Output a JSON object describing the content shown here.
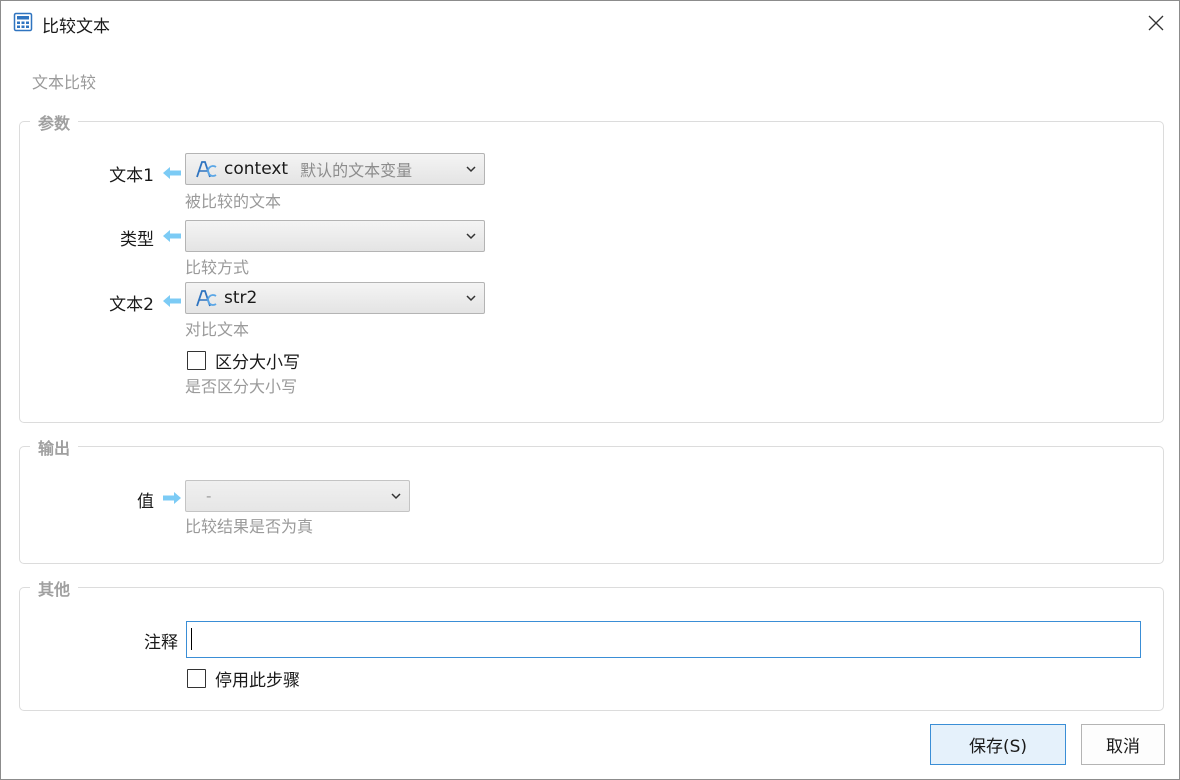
{
  "window": {
    "title": "比较文本",
    "subtitle": "文本比较"
  },
  "groups": {
    "params_title": "参数",
    "output_title": "输出",
    "other_title": "其他"
  },
  "params": {
    "text1": {
      "label": "文本1",
      "var_name": "context",
      "var_desc": "默认的文本变量",
      "hint": "被比较的文本"
    },
    "type": {
      "label": "类型",
      "value": "",
      "hint": "比较方式"
    },
    "text2": {
      "label": "文本2",
      "var_name": "str2",
      "hint": "对比文本"
    },
    "case_sensitive": {
      "label": "区分大小写",
      "checked": false,
      "hint": "是否区分大小写"
    }
  },
  "output": {
    "value": {
      "label": "值",
      "selected": "-",
      "hint": "比较结果是否为真"
    }
  },
  "other": {
    "comment": {
      "label": "注释",
      "value": ""
    },
    "disable_step": {
      "label": "停用此步骤",
      "checked": false
    }
  },
  "buttons": {
    "save": "保存(S)",
    "cancel": "取消"
  },
  "colors": {
    "accent_blue": "#3a8ed6",
    "arrow_blue": "#7ccbf5",
    "hint_gray": "#9a9a9a"
  },
  "icons": {
    "app": "calculator-icon",
    "close": "close-icon",
    "arrow": "arrow-left-icon",
    "variable": "text-variable-icon",
    "dropdown": "chevron-down-icon"
  }
}
